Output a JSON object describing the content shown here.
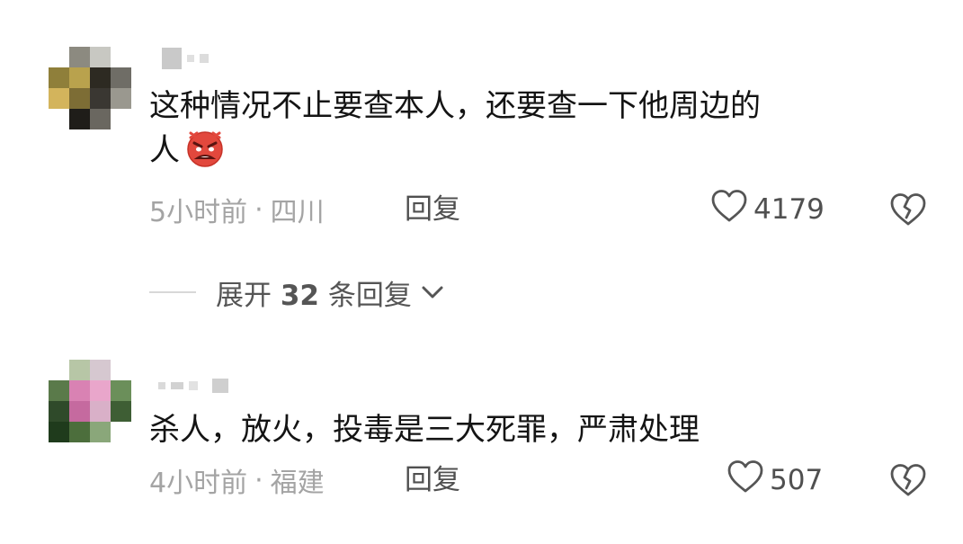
{
  "comments": [
    {
      "text_line1": "这种情况不止要查本人，还要查一下他周边的",
      "text_line2": "人",
      "emoji": "angry-face",
      "time": "5小时前",
      "separator": "·",
      "location": "四川",
      "reply_label": "回复",
      "likes": "4179"
    },
    {
      "text_line1": "杀人，放火，投毒是三大死罪，严肃处理",
      "time": "4小时前",
      "separator": "·",
      "location": "福建",
      "reply_label": "回复",
      "likes": "507"
    }
  ],
  "expand_replies": {
    "prefix": "展开",
    "count": "32",
    "suffix": "条回复"
  },
  "icons": {
    "like": "heart-outline-icon",
    "dislike": "broken-heart-icon",
    "expand": "chevron-down-icon"
  },
  "colors": {
    "primary_text": "#141414",
    "secondary_text": "#a4a4a4",
    "action_text": "#505050",
    "emoji_red": "#e2483d"
  }
}
